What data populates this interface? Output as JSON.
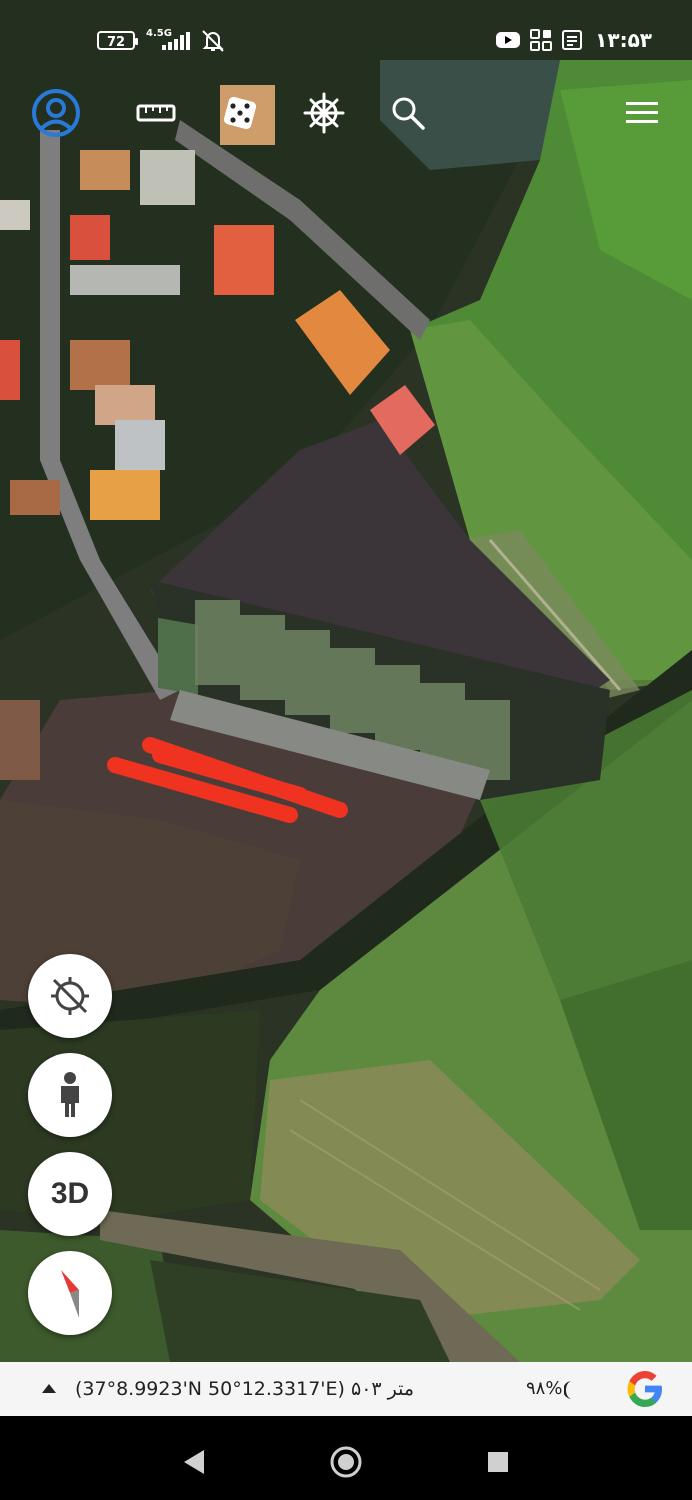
{
  "status_bar": {
    "battery": "72",
    "network": "4.5G",
    "time": "۱۳:۵۳",
    "icons": [
      "battery-icon",
      "signal-icon",
      "mute-bell-icon",
      "youtube-icon",
      "apps-grid-icon",
      "notes-icon"
    ]
  },
  "toolbar": {
    "icons": [
      "profile-icon",
      "ruler-icon",
      "dice-icon",
      "ship-wheel-icon",
      "search-icon",
      "menu-icon"
    ],
    "accent": "#2979d8"
  },
  "map_controls": {
    "buttons": [
      "location-off-icon",
      "pegman-icon",
      "3d-button",
      "compass-icon"
    ],
    "label_3d": "3D"
  },
  "info_bar": {
    "coordinates": "(37°8.9923'N 50°12.3317'E) متر ۵۰۳",
    "scale_percent": "۹۸%",
    "logo": "google-logo-icon"
  },
  "colors": {
    "annotation": "#ef3320",
    "fab_bg": "#ffffff"
  }
}
